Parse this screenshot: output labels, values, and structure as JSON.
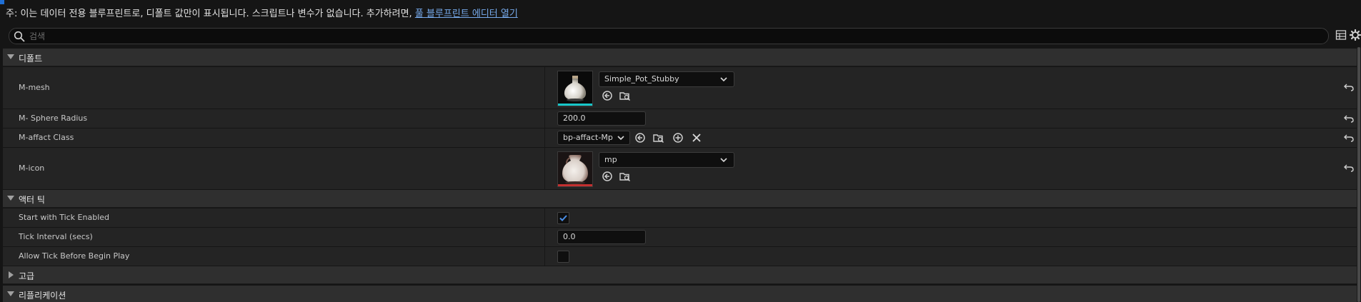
{
  "notice": {
    "text": "주: 이는 데이터 전용 블루프린트로, 디폴트 값만이 표시됩니다. 스크립트나 변수가 없습니다. 추가하려면, ",
    "link": "풀 블루프린트 에디터 열기"
  },
  "search": {
    "placeholder": "검색",
    "value": ""
  },
  "sections": {
    "default": {
      "title": "디폴트"
    },
    "actor_tick": {
      "title": "액터 틱"
    },
    "advanced": {
      "title": "고급"
    },
    "replication": {
      "title": "리플리케이션"
    }
  },
  "properties": {
    "m_mesh": {
      "label": "M-mesh",
      "value": "Simple_Pot_Stubby"
    },
    "m_sphere_radius": {
      "label": "M- Sphere Radius",
      "value": "200.0"
    },
    "m_affact_class": {
      "label": "M-affact Class",
      "value": "bp-affact-Mp"
    },
    "m_icon": {
      "label": "M-icon",
      "value": "mp"
    },
    "start_with_tick_enabled": {
      "label": "Start with Tick Enabled",
      "checked": true
    },
    "tick_interval": {
      "label": "Tick Interval (secs)",
      "value": "0.0"
    },
    "allow_tick_before_begin_play": {
      "label": "Allow Tick Before Begin Play",
      "checked": false
    }
  },
  "colors": {
    "accent_link": "#76a9ea",
    "mesh_thumb_bar": "#17c6c9",
    "texture_thumb_bar": "#c43030",
    "checkbox_check": "#4a8fe8"
  },
  "icons": {
    "toolbar": [
      "grid-view-icon",
      "settings-gear-icon"
    ],
    "reset": "reset-to-default-icon",
    "asset_actions": [
      "use-selected-asset-icon",
      "browse-asset-icon"
    ],
    "class_actions": [
      "use-selected-asset-icon",
      "browse-asset-icon",
      "add-icon",
      "clear-icon"
    ]
  }
}
